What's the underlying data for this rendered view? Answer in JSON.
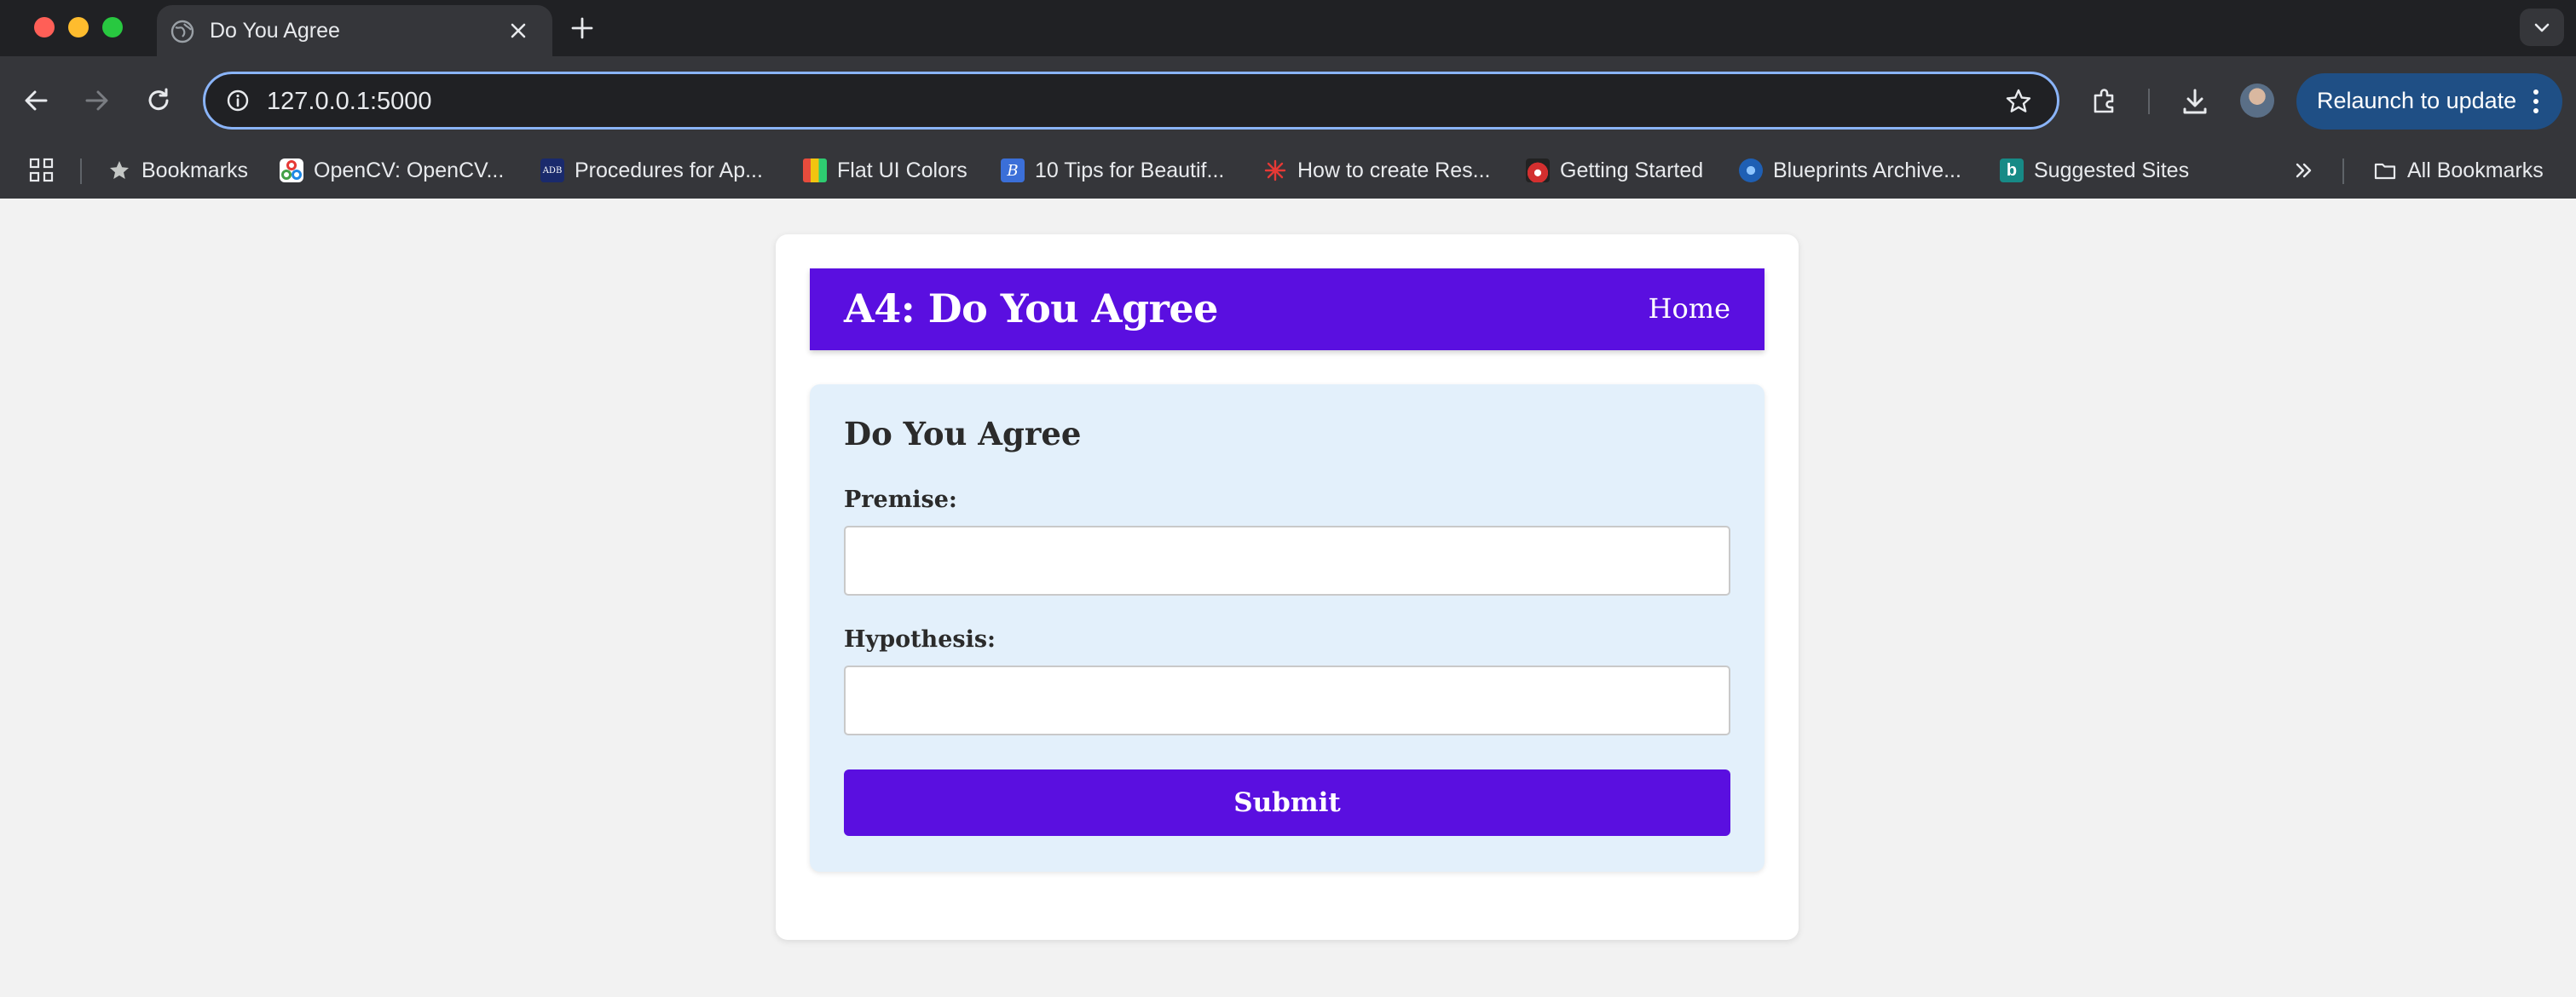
{
  "browser": {
    "tab": {
      "title": "Do You Agree",
      "favicon": "globe-icon"
    },
    "address_bar": {
      "url": "127.0.0.1:5000"
    },
    "relaunch_label": "Relaunch to update",
    "bookmarks": [
      {
        "label": "Bookmarks",
        "icon": "star-icon"
      },
      {
        "label": "OpenCV: OpenCV...",
        "icon": "opencv-icon"
      },
      {
        "label": "Procedures for Ap...",
        "icon": "adb-icon"
      },
      {
        "label": "Flat UI Colors",
        "icon": "flat-ui-icon"
      },
      {
        "label": "10 Tips for Beautif...",
        "icon": "tips-icon"
      },
      {
        "label": "How to create Res...",
        "icon": "spark-icon"
      },
      {
        "label": "Getting Started",
        "icon": "redhat-icon"
      },
      {
        "label": "Blueprints Archive...",
        "icon": "blueprint-icon"
      },
      {
        "label": "Suggested Sites",
        "icon": "bing-icon"
      }
    ],
    "all_bookmarks_label": "All Bookmarks"
  },
  "page": {
    "header": {
      "title": "A4: Do You Agree",
      "home_link": "Home"
    },
    "form": {
      "title": "Do You Agree",
      "premise_label": "Premise:",
      "premise_value": "",
      "hypothesis_label": "Hypothesis:",
      "hypothesis_value": "",
      "submit_label": "Submit"
    }
  },
  "colors": {
    "accent": "#5a0fe0",
    "form_background": "#e3f0fb",
    "page_background": "#f2f2f2",
    "address_bar_focus": "#8ab4f8",
    "relaunch_button": "#1f4f85"
  }
}
